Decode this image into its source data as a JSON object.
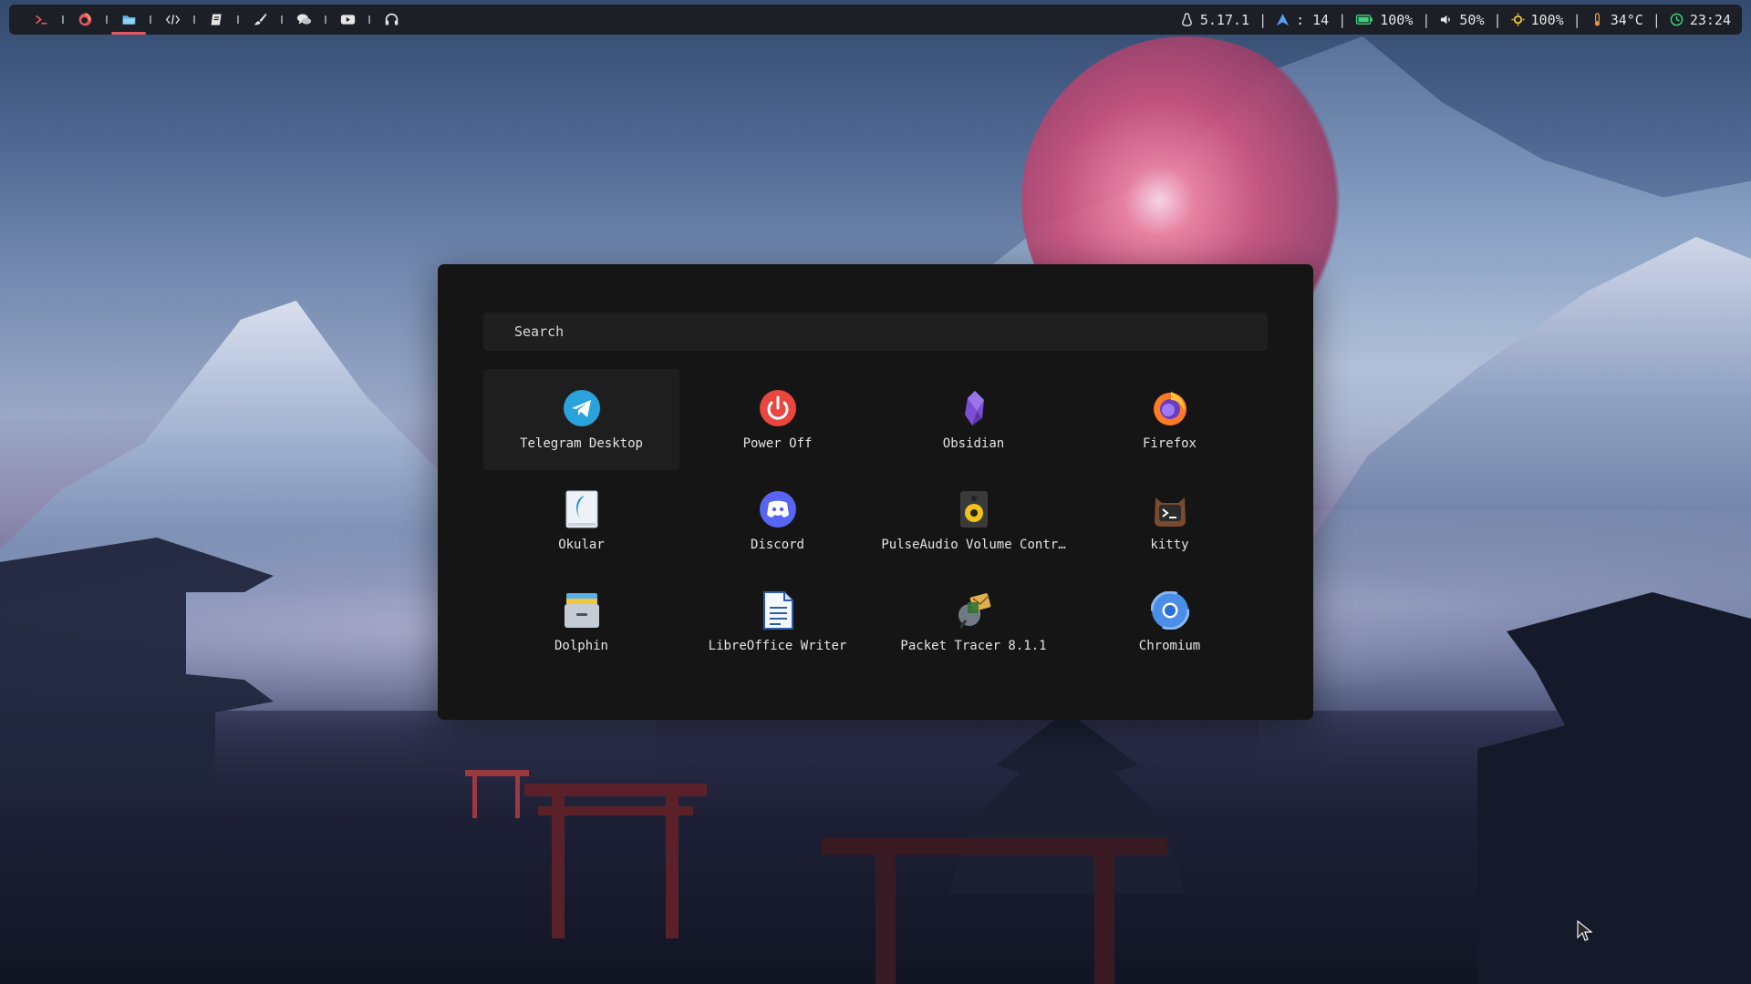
{
  "desktop": {
    "wallpaper": "mountain-torii-landscape"
  },
  "topbar": {
    "workspaces": [
      {
        "icon": "terminal-icon",
        "color": "#e0595f"
      },
      {
        "icon": "firefox-icon",
        "color": "#e0595f"
      },
      {
        "icon": "folder-icon",
        "color": "#5fb8e8",
        "active": true
      },
      {
        "icon": "code-icon",
        "color": "#e6e6e6"
      },
      {
        "icon": "book-icon",
        "color": "#e6e6e6"
      },
      {
        "icon": "brush-icon",
        "color": "#e6e6e6"
      },
      {
        "icon": "chat-icon",
        "color": "#e6e6e6"
      },
      {
        "icon": "youtube-icon",
        "color": "#e6e6e6"
      },
      {
        "icon": "headphones-icon",
        "color": "#e6e6e6"
      }
    ],
    "status": {
      "kernel": "5.17.1",
      "updates": ": 14",
      "battery": "100%",
      "volume": "50%",
      "brightness": "100%",
      "temperature": "34°C",
      "clock": "23:24",
      "separator": "|"
    },
    "colors": {
      "battery": "#3fd07a",
      "updates": "#5b9cf5",
      "brightness": "#e8c23a",
      "temperature": "#e6953a",
      "clock": "#3fd07a"
    }
  },
  "launcher": {
    "search": {
      "placeholder": "Search",
      "value": ""
    },
    "apps": [
      {
        "name": "Telegram Desktop",
        "icon": "telegram-icon",
        "selected": true
      },
      {
        "name": "Power Off",
        "icon": "power-icon"
      },
      {
        "name": "Obsidian",
        "icon": "obsidian-icon"
      },
      {
        "name": "Firefox",
        "icon": "firefox-icon"
      },
      {
        "name": "Okular",
        "icon": "okular-icon"
      },
      {
        "name": "Discord",
        "icon": "discord-icon"
      },
      {
        "name": "PulseAudio Volume Contr…",
        "icon": "speaker-icon"
      },
      {
        "name": "kitty",
        "icon": "kitty-icon"
      },
      {
        "name": "Dolphin",
        "icon": "dolphin-icon"
      },
      {
        "name": "LibreOffice Writer",
        "icon": "writer-icon"
      },
      {
        "name": "Packet Tracer 8.1.1",
        "icon": "packet-tracer-icon"
      },
      {
        "name": "Chromium",
        "icon": "chromium-icon"
      }
    ]
  }
}
